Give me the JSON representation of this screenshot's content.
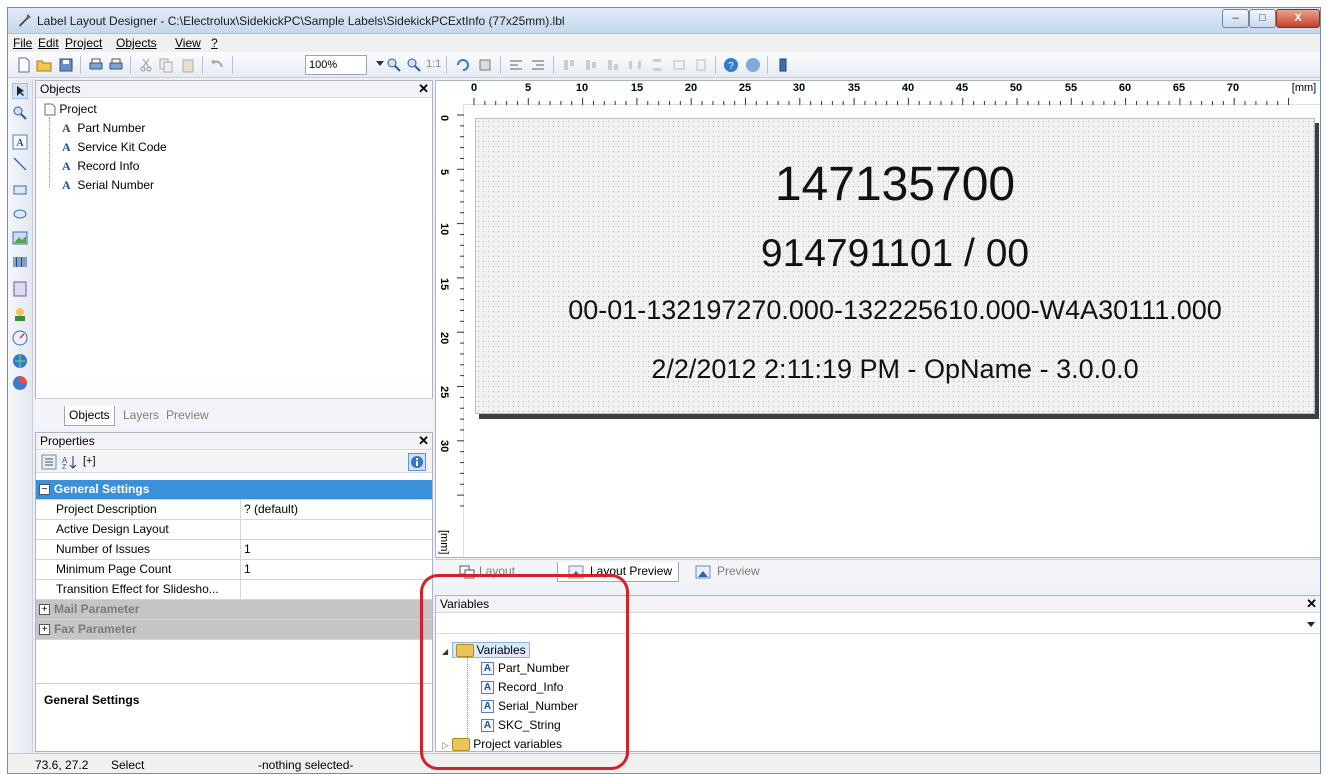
{
  "window": {
    "title": "Label Layout Designer - C:\\Electrolux\\SidekickPC\\Sample Labels\\SidekickPCExtInfo (77x25mm).lbl",
    "controls": {
      "minimize": "–",
      "maximize": "□",
      "close": "X"
    }
  },
  "menu": [
    "File",
    "Edit",
    "Project",
    "Objects",
    "View",
    "?"
  ],
  "toolbar": {
    "zoom": "100%",
    "actual_size": "1:1"
  },
  "objects_panel": {
    "title": "Objects",
    "root": "Project",
    "items": [
      "Part Number",
      "Service Kit Code",
      "Record Info",
      "Serial Number"
    ],
    "tabs": [
      "Objects",
      "Layers",
      "Preview"
    ]
  },
  "properties_panel": {
    "title": "Properties",
    "toolbar_label": "[+]",
    "categories": [
      {
        "name": "General Settings",
        "expanded": true,
        "selected": true
      },
      {
        "name": "Mail Parameter",
        "expanded": false
      },
      {
        "name": "Fax Parameter",
        "expanded": false
      }
    ],
    "rows": [
      {
        "key": "Project Description",
        "value": "? (default)"
      },
      {
        "key": "Active Design Layout",
        "value": ""
      },
      {
        "key": "Number of Issues",
        "value": "1"
      },
      {
        "key": "Minimum Page Count",
        "value": "1"
      },
      {
        "key": "Transition Effect for Slidesho...",
        "value": ""
      }
    ],
    "description_title": "General Settings"
  },
  "ruler": {
    "top_ticks": [
      "0",
      "5",
      "10",
      "15",
      "20",
      "25",
      "30",
      "35",
      "40",
      "45",
      "50",
      "55",
      "60",
      "65",
      "70"
    ],
    "unit": "[mm]",
    "left_ticks": [
      "0",
      "5",
      "10",
      "15",
      "20",
      "25",
      "30"
    ],
    "left_unit": "[mm]"
  },
  "label": {
    "lines": [
      "147135700",
      "914791101 / 00",
      "00-01-132197270.000-132225610.000-W4A30111.000",
      "2/2/2012 2:11:19 PM - OpName - 3.0.0.0"
    ]
  },
  "view_tabs": [
    "Layout",
    "Layout Preview",
    "Preview"
  ],
  "variables_panel": {
    "title": "Variables",
    "root": "Variables",
    "items": [
      "Part_Number",
      "Record_Info",
      "Serial_Number",
      "SKC_String"
    ],
    "project_vars": "Project variables"
  },
  "status": {
    "coords": "73.6, 27.2",
    "mode": "Select",
    "selection": "-nothing selected-"
  },
  "colors": {
    "highlight": "#d8202a",
    "selected_category": "#3c8fd9"
  }
}
